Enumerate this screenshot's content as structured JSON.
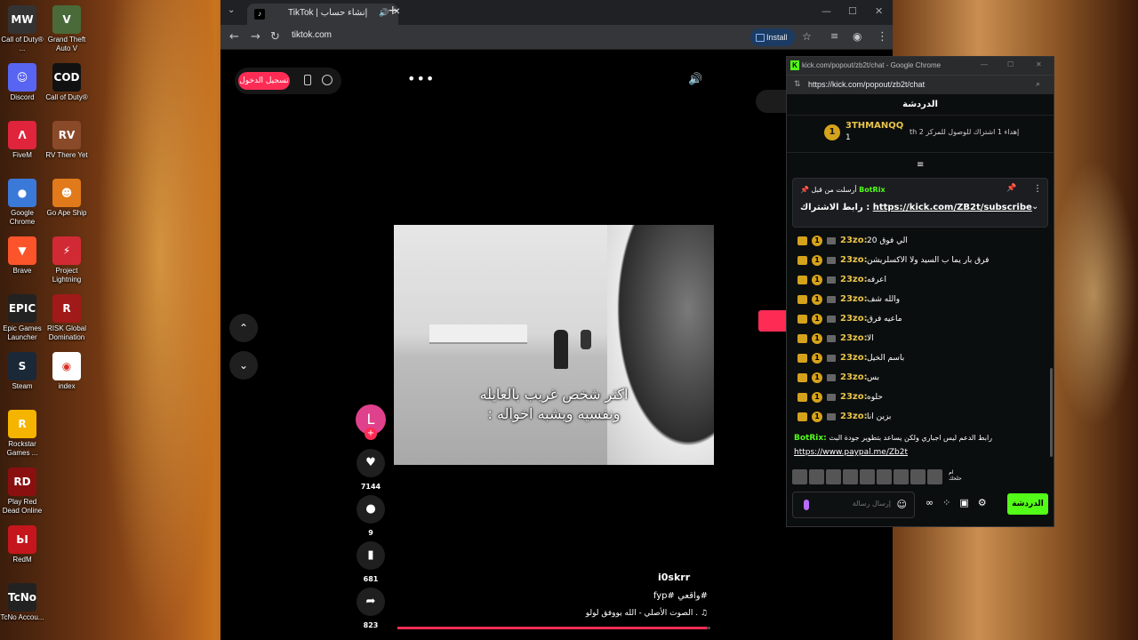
{
  "desktop": {
    "icons": [
      {
        "label": "Call of Duty® ...",
        "color": "#333333",
        "glyph": "MW"
      },
      {
        "label": "Grand Theft Auto V",
        "color": "#4a6a3a",
        "glyph": "V"
      },
      {
        "label": "Discord",
        "color": "#5865f2",
        "glyph": "☺"
      },
      {
        "label": "Call of Duty®",
        "color": "#111111",
        "glyph": "COD"
      },
      {
        "label": "FiveM",
        "color": "#e0243b",
        "glyph": "Λ"
      },
      {
        "label": "RV There Yet",
        "color": "#8a4a2a",
        "glyph": "RV"
      },
      {
        "label": "Google Chrome",
        "color": "#3b79d8",
        "glyph": "●"
      },
      {
        "label": "Go Ape Ship",
        "color": "#e07a1a",
        "glyph": "☻"
      },
      {
        "label": "Brave",
        "color": "#fb542b",
        "glyph": "▼"
      },
      {
        "label": "Project Lightning",
        "color": "#d22a35",
        "glyph": "⚡"
      },
      {
        "label": "Epic Games Launcher",
        "color": "#222222",
        "glyph": "EPIC"
      },
      {
        "label": "RISK Global Domination",
        "color": "#a01a1a",
        "glyph": "R"
      },
      {
        "label": "Steam",
        "color": "#1b2838",
        "glyph": "S"
      },
      {
        "label": "index",
        "color": "#ffffff",
        "glyph": "◉"
      },
      {
        "label": "Rockstar Games ...",
        "color": "#f5b400",
        "glyph": "R"
      },
      {
        "label": "Play Red Dead Online",
        "color": "#8a1010",
        "glyph": "RD"
      },
      {
        "label": "RedM",
        "color": "#c4161c",
        "glyph": "ЬΙ"
      },
      {
        "label": "TcNo Accou...",
        "color": "#222222",
        "glyph": "TcNo"
      }
    ]
  },
  "browser": {
    "tab_title": "TikTok | إنشاء حساب",
    "url": "tiktok.com",
    "install_label": "Install",
    "new_tab": "+",
    "tab_close": "✕",
    "tab_audio": "🔊",
    "tab_dropdown": "⌄",
    "window_minimize": "—",
    "window_maximize": "☐",
    "window_close": "✕"
  },
  "tiktok": {
    "login_label": "تسجيل الدخول",
    "more_label": "•••",
    "speaker_icon": "🔊",
    "caption_line1": "اكثر شخص غريب بالعايله",
    "caption_line2": "ونفسيه ويشبه اخواله :",
    "avatar_letter": "L",
    "avatar_plus": "+",
    "likes": "7144",
    "comments": "9",
    "saves": "681",
    "shares": "823",
    "author": "i0skrr",
    "description": "#واقعي #fyp",
    "music": "♫ . الصوت الأصلي - الله يووفق لولو",
    "progress": 0.99,
    "nav_up": "⌃",
    "nav_down": "⌄",
    "icons": {
      "heart": "♥",
      "comment": "●",
      "bookmark": "▮",
      "share": "➦"
    }
  },
  "kick": {
    "window_title": "kick.com/popout/zb2t/chat - Google Chrome",
    "url": "https://kick.com/popout/zb2t/chat",
    "header": "الدردشة",
    "goal": {
      "medal": "1",
      "name": "3THMANQQ",
      "count": "1",
      "text": "إهداء 1 اشتراك للوصول للمركز 2 th"
    },
    "pinned": {
      "line1_prefix": "أرسلت من قبل",
      "bot_name": "BotRix",
      "line2_label": "رابط الاشتراك :",
      "link": "https://kick.com/ZB2t/subscribe"
    },
    "messages": [
      {
        "user": "23zo:",
        "text": "الي فوق 20"
      },
      {
        "user": "23zo:",
        "text": "فرق بار يما ب السيد ولا الاكسلريشن"
      },
      {
        "user": "23zo:",
        "text": "اعرفه"
      },
      {
        "user": "23zo:",
        "text": "والله شف"
      },
      {
        "user": "23zo:",
        "text": "ماعيه فرق"
      },
      {
        "user": "23zo:",
        "text": "الا"
      },
      {
        "user": "23zo:",
        "text": "باسم الخيل"
      },
      {
        "user": "23zo:",
        "text": "بس"
      },
      {
        "user": "23zo:",
        "text": "حلوه"
      },
      {
        "user": "23zo:",
        "text": "بزين انا"
      }
    ],
    "bot_message": {
      "user": "BotRix:",
      "text": "رابط الدعم ليس اجباري ولكن يساعد بتطوير جودة البث",
      "link": "https://www.paypal.me/Zb2t"
    },
    "emote_more": "ام حلحك",
    "input_placeholder": "إرسال رسالة",
    "send_label": "الدردشة",
    "colors": {
      "accent": "#53fc18",
      "gold": "#e8c44a"
    }
  }
}
